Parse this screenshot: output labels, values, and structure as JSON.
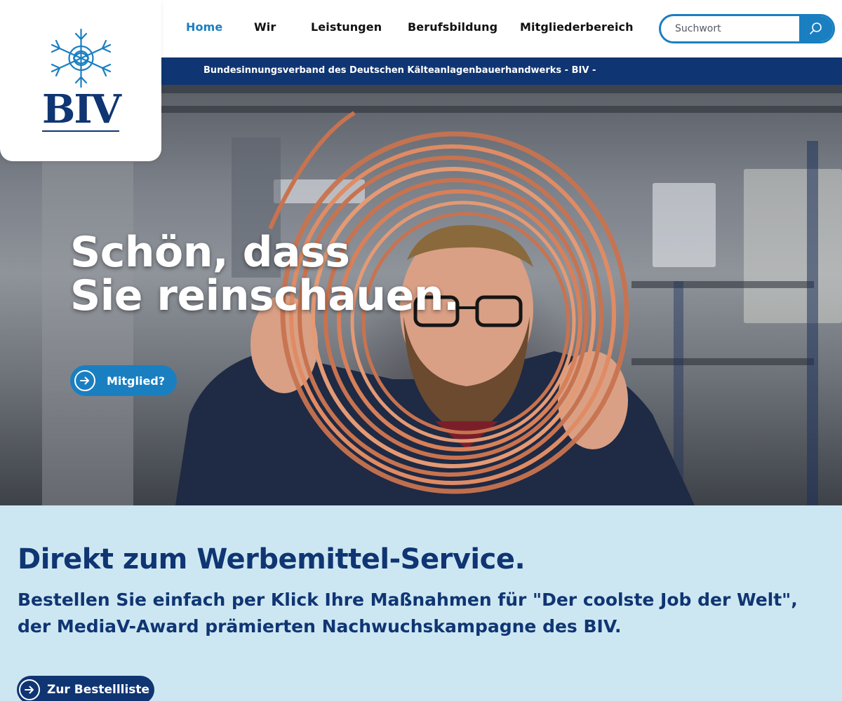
{
  "brand": {
    "logo_text": "BIV",
    "logo_icon": "snowflake-crest-icon"
  },
  "nav": {
    "items": [
      {
        "label": "Home",
        "active": true
      },
      {
        "label": "Wir",
        "active": false
      },
      {
        "label": "Leistungen",
        "active": false
      },
      {
        "label": "Berufsbildung",
        "active": false
      },
      {
        "label": "Mitgliederbereich",
        "active": false
      }
    ]
  },
  "search": {
    "placeholder": "Suchwort",
    "value": "",
    "icon": "search-icon"
  },
  "subbar": {
    "text": "Bundesinnungsverband des Deutschen Kälteanlagenbauerhandwerks - BIV -"
  },
  "hero": {
    "title_line1": "Schön, dass",
    "title_line2": "Sie reinschauen.",
    "button_label": "Mitglied?",
    "button_icon": "arrow-right-circle-icon"
  },
  "promo": {
    "title": "Direkt zum Werbemittel-Service.",
    "text": "Bestellen Sie einfach per Klick Ihre Maßnahmen für \"Der coolste Job der Welt\", der MediaV-Award prämierten Nachwuchskampagne des BIV.",
    "button_label": "Zur Bestellliste",
    "button_icon": "arrow-right-circle-icon"
  },
  "colors": {
    "primary_blue": "#1a7fc1",
    "navy": "#0f3573",
    "promo_bg": "#cde7f2",
    "copper": "#c8734f"
  }
}
